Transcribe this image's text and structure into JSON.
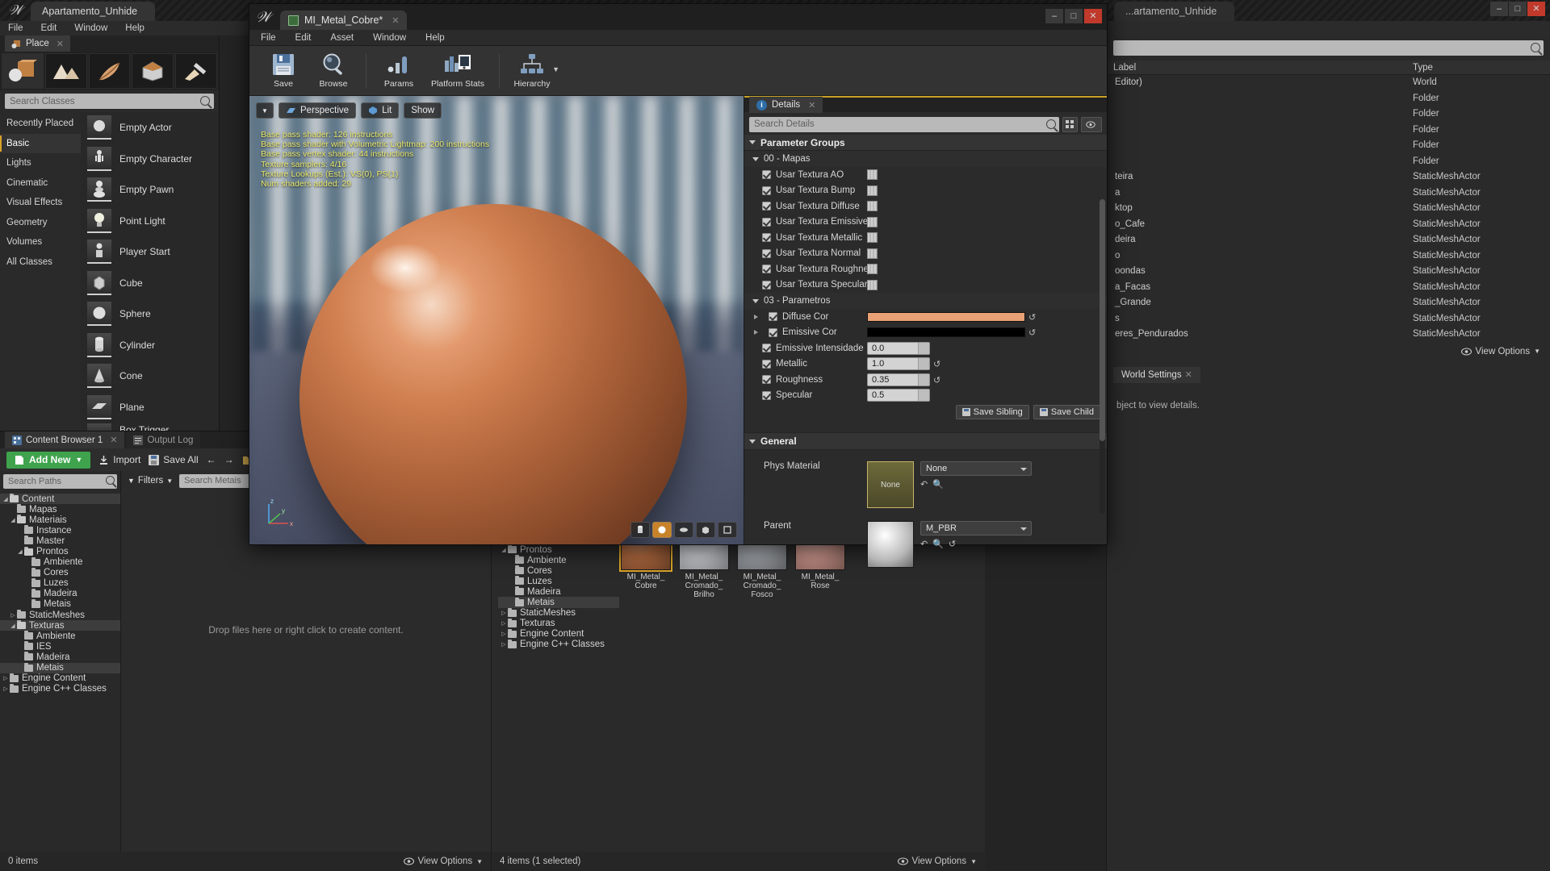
{
  "main_window": {
    "title": "Apartamento_Unhide",
    "title_right": "...artamento_Unhide",
    "menu": [
      "File",
      "Edit",
      "Window",
      "Help"
    ],
    "window_buttons": [
      "–",
      "□",
      "✕"
    ]
  },
  "place_panel": {
    "tab_label": "Place",
    "close": "✕",
    "mode_icons": [
      "place-mode-icon",
      "landscape-mode-icon",
      "foliage-mode-icon",
      "geometry-editing-icon",
      "paint-mode-icon"
    ],
    "search_placeholder": "Search Classes",
    "categories": [
      {
        "label": "Recently Placed",
        "selected": false
      },
      {
        "label": "Basic",
        "selected": true
      },
      {
        "label": "Lights",
        "selected": false
      },
      {
        "label": "Cinematic",
        "selected": false
      },
      {
        "label": "Visual Effects",
        "selected": false
      },
      {
        "label": "Geometry",
        "selected": false
      },
      {
        "label": "Volumes",
        "selected": false
      },
      {
        "label": "All Classes",
        "selected": false
      }
    ],
    "items": [
      {
        "label": "Empty Actor"
      },
      {
        "label": "Empty Character"
      },
      {
        "label": "Empty Pawn"
      },
      {
        "label": "Point Light"
      },
      {
        "label": "Player Start"
      },
      {
        "label": "Cube"
      },
      {
        "label": "Sphere"
      },
      {
        "label": "Cylinder"
      },
      {
        "label": "Cone"
      },
      {
        "label": "Plane"
      },
      {
        "label": "Box Trigger"
      }
    ]
  },
  "content_browser": {
    "tabs": [
      {
        "label": "Content Browser 1",
        "active": true
      },
      {
        "label": "Output Log",
        "active": false
      }
    ],
    "toolbar": {
      "add_new": "Add New",
      "import": "Import",
      "save_all": "Save All",
      "back": "←",
      "forward": "→"
    },
    "path_search_placeholder": "Search Paths",
    "tree": [
      {
        "label": "Content",
        "depth": 0,
        "expanded": true,
        "selected": true
      },
      {
        "label": "Mapas",
        "depth": 1,
        "expanded": null,
        "selected": false
      },
      {
        "label": "Materiais",
        "depth": 1,
        "expanded": true,
        "selected": false
      },
      {
        "label": "Instance",
        "depth": 2,
        "expanded": null,
        "selected": false
      },
      {
        "label": "Master",
        "depth": 2,
        "expanded": null,
        "selected": false
      },
      {
        "label": "Prontos",
        "depth": 2,
        "expanded": true,
        "selected": false
      },
      {
        "label": "Ambiente",
        "depth": 3,
        "expanded": null,
        "selected": false
      },
      {
        "label": "Cores",
        "depth": 3,
        "expanded": null,
        "selected": false
      },
      {
        "label": "Luzes",
        "depth": 3,
        "expanded": null,
        "selected": false
      },
      {
        "label": "Madeira",
        "depth": 3,
        "expanded": null,
        "selected": false
      },
      {
        "label": "Metais",
        "depth": 3,
        "expanded": null,
        "selected": false
      },
      {
        "label": "StaticMeshes",
        "depth": 1,
        "expanded": false,
        "selected": false
      },
      {
        "label": "Texturas",
        "depth": 1,
        "expanded": true,
        "selected": true
      },
      {
        "label": "Ambiente",
        "depth": 2,
        "expanded": null,
        "selected": false
      },
      {
        "label": "IES",
        "depth": 2,
        "expanded": null,
        "selected": false
      },
      {
        "label": "Madeira",
        "depth": 2,
        "expanded": null,
        "selected": false
      },
      {
        "label": "Metais",
        "depth": 2,
        "expanded": null,
        "selected": true
      },
      {
        "label": "Engine Content",
        "depth": 0,
        "expanded": false,
        "selected": false
      },
      {
        "label": "Engine C++ Classes",
        "depth": 0,
        "expanded": false,
        "selected": false
      }
    ],
    "filters_label": "Filters",
    "asset_search_placeholder": "Search Metais",
    "drop_hint": "Drop files here or right click to create content.",
    "status_left": "0 items",
    "view_options": "View Options"
  },
  "content_browser_2": {
    "tree": [
      {
        "label": "Prontos",
        "depth": 0,
        "expanded": true,
        "selected": false
      },
      {
        "label": "Ambiente",
        "depth": 1,
        "expanded": null,
        "selected": false
      },
      {
        "label": "Cores",
        "depth": 1,
        "expanded": null,
        "selected": false
      },
      {
        "label": "Luzes",
        "depth": 1,
        "expanded": null,
        "selected": false
      },
      {
        "label": "Madeira",
        "depth": 1,
        "expanded": null,
        "selected": false
      },
      {
        "label": "Metais",
        "depth": 1,
        "expanded": null,
        "selected": true
      },
      {
        "label": "StaticMeshes",
        "depth": 0,
        "expanded": false,
        "selected": false
      },
      {
        "label": "Texturas",
        "depth": 0,
        "expanded": false,
        "selected": false
      },
      {
        "label": "Engine Content",
        "depth": 0,
        "expanded": false,
        "selected": false
      },
      {
        "label": "Engine C++ Classes",
        "depth": 0,
        "expanded": false,
        "selected": false
      }
    ],
    "assets": [
      {
        "name": "MI_Metal_\nCobre",
        "color": "#b0693f",
        "selected": true
      },
      {
        "name": "MI_Metal_\nCromado_\nBrilho",
        "color": "#c9ccd0",
        "selected": false
      },
      {
        "name": "MI_Metal_\nCromado_\nFosco",
        "color": "#9fa3a8",
        "selected": false
      },
      {
        "name": "MI_Metal_\nRose",
        "color": "#c79288",
        "selected": false
      }
    ],
    "status_left": "4 items (1 selected)",
    "view_options": "View Options"
  },
  "outliner": {
    "search_placeholder": "",
    "columns": [
      "Label",
      "Type"
    ],
    "rows": [
      {
        "name": "Editor)",
        "type": "World"
      },
      {
        "name": "",
        "type": "Folder"
      },
      {
        "name": "",
        "type": "Folder"
      },
      {
        "name": "",
        "type": "Folder"
      },
      {
        "name": "",
        "type": "Folder"
      },
      {
        "name": "",
        "type": "Folder"
      },
      {
        "name": "teira",
        "type": "StaticMeshActor"
      },
      {
        "name": "a",
        "type": "StaticMeshActor"
      },
      {
        "name": "ktop",
        "type": "StaticMeshActor"
      },
      {
        "name": "o_Cafe",
        "type": "StaticMeshActor"
      },
      {
        "name": "deira",
        "type": "StaticMeshActor"
      },
      {
        "name": "o",
        "type": "StaticMeshActor"
      },
      {
        "name": "oondas",
        "type": "StaticMeshActor"
      },
      {
        "name": "a_Facas",
        "type": "StaticMeshActor"
      },
      {
        "name": "_Grande",
        "type": "StaticMeshActor"
      },
      {
        "name": "s",
        "type": "StaticMeshActor"
      },
      {
        "name": "eres_Pendurados",
        "type": "StaticMeshActor"
      }
    ],
    "view_options": "View Options",
    "world_settings_tab": "World Settings",
    "no_selection_msg": "bject to view details."
  },
  "material_editor": {
    "tab_title": "MI_Metal_Cobre*",
    "tab_close": "✕",
    "window_buttons": [
      "–",
      "□",
      "✕"
    ],
    "menu": [
      "File",
      "Edit",
      "Asset",
      "Window",
      "Help"
    ],
    "toolbar": [
      {
        "label": "Save",
        "icon": "save-icon"
      },
      {
        "label": "Browse",
        "icon": "browse-icon"
      },
      {
        "label": "Params",
        "icon": "params-icon"
      },
      {
        "label": "Platform Stats",
        "icon": "platform-stats-icon"
      },
      {
        "label": "Hierarchy",
        "icon": "hierarchy-icon"
      }
    ],
    "viewport": {
      "perspective": "Perspective",
      "lit": "Lit",
      "show": "Show",
      "stats": [
        "Base pass shader: 126 instructions",
        "Base pass shader with Volumetric Lightmap: 200 instructions",
        "Base pass vertex shader: 44 instructions",
        "Texture samplers: 4/16",
        "Texture Lookups (Est.): VS(0), PS(1)",
        "Num shaders added: 29"
      ],
      "axis_labels": [
        "z",
        "y",
        "x"
      ]
    },
    "details": {
      "tab_label": "Details",
      "tab_close": "✕",
      "search_placeholder": "Search Details",
      "group_header": "Parameter Groups",
      "groups": [
        {
          "name": "00 - Mapas",
          "params": [
            {
              "label": "Usar Textura AO",
              "checked": true,
              "type": "texture"
            },
            {
              "label": "Usar Textura Bump",
              "checked": true,
              "type": "texture"
            },
            {
              "label": "Usar Textura Diffuse",
              "checked": true,
              "type": "texture"
            },
            {
              "label": "Usar Textura Emissive",
              "checked": true,
              "type": "texture"
            },
            {
              "label": "Usar Textura Metallic",
              "checked": true,
              "type": "texture"
            },
            {
              "label": "Usar Textura Normal",
              "checked": true,
              "type": "texture"
            },
            {
              "label": "Usar Textura Roughness",
              "checked": true,
              "type": "texture"
            },
            {
              "label": "Usar Textura Specular",
              "checked": true,
              "type": "texture"
            }
          ]
        },
        {
          "name": "03 - Parametros",
          "params": [
            {
              "label": "Diffuse Cor",
              "checked": true,
              "type": "color",
              "color": "#e8a074",
              "expandable": true
            },
            {
              "label": "Emissive Cor",
              "checked": true,
              "type": "color",
              "color": "#000000",
              "expandable": true
            },
            {
              "label": "Emissive Intensidade",
              "checked": true,
              "type": "number",
              "value": "0.0"
            },
            {
              "label": "Metallic",
              "checked": true,
              "type": "number",
              "value": "1.0",
              "reset": true
            },
            {
              "label": "Roughness",
              "checked": true,
              "type": "number",
              "value": "0.35",
              "reset": true
            },
            {
              "label": "Specular",
              "checked": true,
              "type": "number",
              "value": "0.5"
            }
          ]
        }
      ],
      "save_sibling": "Save Sibling",
      "save_child": "Save Child",
      "general_header": "General",
      "general": [
        {
          "label": "Phys Material",
          "thumb_label": "None",
          "value": "None"
        },
        {
          "label": "Parent",
          "thumb_label": "",
          "value": "M_PBR"
        }
      ]
    }
  },
  "colors": {
    "accent_yellow": "#c9a227",
    "add_new_green": "#3fa34d",
    "diffuse": "#e8a074",
    "close_red": "#c0392b"
  }
}
